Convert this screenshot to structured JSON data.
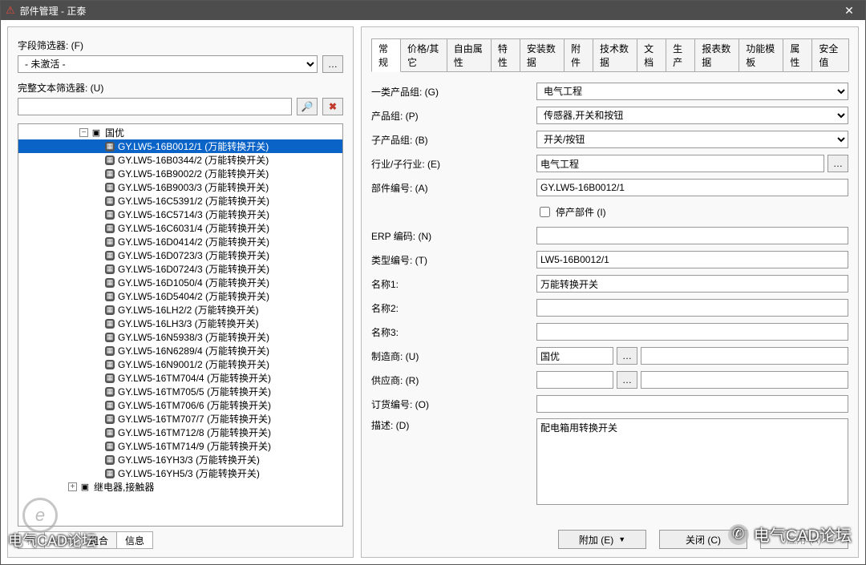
{
  "window": {
    "title": "部件管理 - 正泰"
  },
  "left": {
    "field_filter_label": "字段筛选器: (F)",
    "field_filter_value": "- 未激活 -",
    "text_filter_label": "完整文本筛选器: (U)",
    "text_filter_value": "",
    "search_btn": "🔍",
    "tree_root": "国优",
    "tree_selected": "GY.LW5-16B0012/1 (万能转换开关)",
    "tree_items": [
      "GY.LW5-16B0012/1 (万能转换开关)",
      "GY.LW5-16B0344/2 (万能转换开关)",
      "GY.LW5-16B9002/2 (万能转换开关)",
      "GY.LW5-16B9003/3 (万能转换开关)",
      "GY.LW5-16C5391/2 (万能转换开关)",
      "GY.LW5-16C5714/3 (万能转换开关)",
      "GY.LW5-16C6031/4 (万能转换开关)",
      "GY.LW5-16D0414/2 (万能转换开关)",
      "GY.LW5-16D0723/3 (万能转换开关)",
      "GY.LW5-16D0724/3 (万能转换开关)",
      "GY.LW5-16D1050/4 (万能转换开关)",
      "GY.LW5-16D5404/2 (万能转换开关)",
      "GY.LW5-16LH2/2 (万能转换开关)",
      "GY.LW5-16LH3/3 (万能转换开关)",
      "GY.LW5-16N5938/3 (万能转换开关)",
      "GY.LW5-16N6289/4 (万能转换开关)",
      "GY.LW5-16N9001/2 (万能转换开关)",
      "GY.LW5-16TM704/4 (万能转换开关)",
      "GY.LW5-16TM705/5 (万能转换开关)",
      "GY.LW5-16TM706/6 (万能转换开关)",
      "GY.LW5-16TM707/7 (万能转换开关)",
      "GY.LW5-16TM712/8 (万能转换开关)",
      "GY.LW5-16TM714/9 (万能转换开关)",
      "GY.LW5-16YH3/3 (万能转换开关)",
      "GY.LW5-16YH5/3 (万能转换开关)"
    ],
    "tree_sibling": "继电器,接触器",
    "bottom_tabs": {
      "tree": "树",
      "list": "列表",
      "combo": "组合",
      "info": "信息"
    }
  },
  "right": {
    "tabs": [
      "常规",
      "价格/其它",
      "自由属性",
      "特性",
      "安装数据",
      "附件",
      "技术数据",
      "文档",
      "生产",
      "报表数据",
      "功能模板",
      "属性",
      "安全值"
    ],
    "active_tab": "常规",
    "fields": {
      "group1": {
        "label": "一类产品组: (G)",
        "value": "电气工程"
      },
      "prodgroup": {
        "label": "产品组: (P)",
        "value": "传感器,开关和按钮"
      },
      "subgroup": {
        "label": "子产品组: (B)",
        "value": "开关/按钮"
      },
      "industry": {
        "label": "行业/子行业: (E)",
        "value": "电气工程"
      },
      "partno": {
        "label": "部件编号: (A)",
        "value": "GY.LW5-16B0012/1"
      },
      "discontinued": {
        "label": "停产部件 (I)"
      },
      "erp": {
        "label": "ERP 编码: (N)",
        "value": ""
      },
      "typeno": {
        "label": "类型编号: (T)",
        "value": "LW5-16B0012/1"
      },
      "name1": {
        "label": "名称1:",
        "value": "万能转换开关"
      },
      "name2": {
        "label": "名称2:",
        "value": ""
      },
      "name3": {
        "label": "名称3:",
        "value": ""
      },
      "manuf": {
        "label": "制造商: (U)",
        "value": "国优"
      },
      "supplier": {
        "label": "供应商: (R)",
        "value": ""
      },
      "orderno": {
        "label": "订货编号: (O)",
        "value": ""
      },
      "desc": {
        "label": "描述: (D)",
        "value": "配电箱用转换开关"
      }
    },
    "buttons": {
      "extra": "附加 (E)",
      "close": "关闭 (C)",
      "apply": "应用 (A)"
    }
  },
  "watermark": {
    "big": "电气CAD论坛",
    "small": "电气CAD论坛"
  }
}
